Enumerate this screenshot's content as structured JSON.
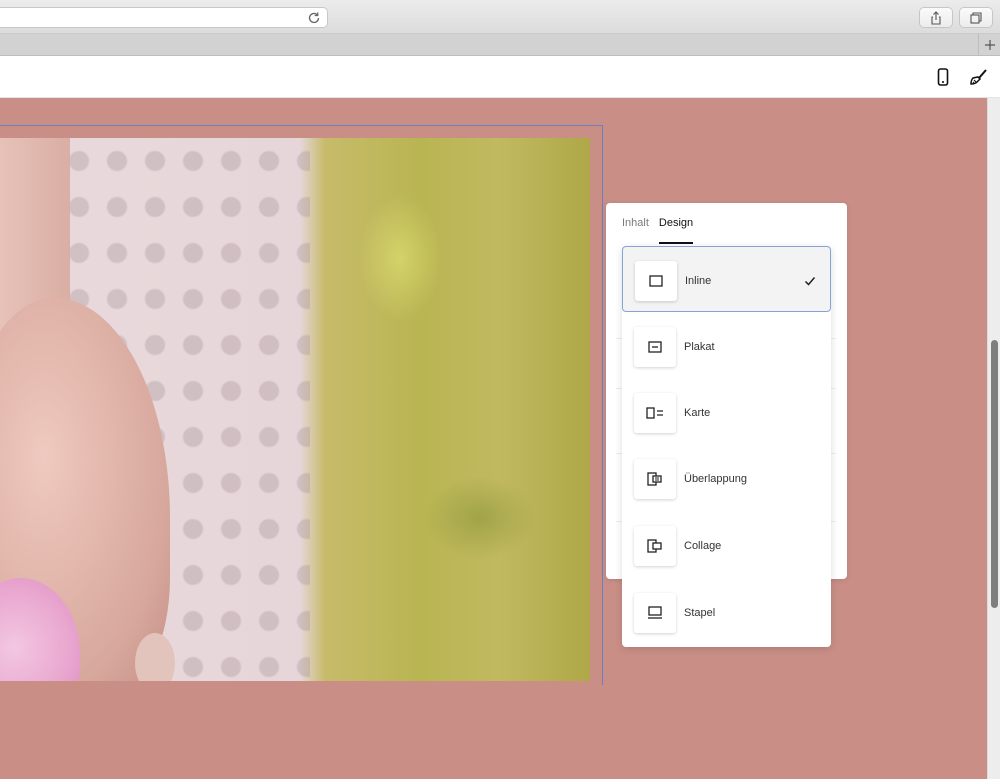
{
  "panel": {
    "tabs": [
      {
        "label": "Inhalt",
        "active": false
      },
      {
        "label": "Design",
        "active": true
      }
    ]
  },
  "dropdown": {
    "options": [
      {
        "label": "Inline",
        "icon": "layout-inline-icon",
        "selected": true
      },
      {
        "label": "Plakat",
        "icon": "layout-poster-icon",
        "selected": false
      },
      {
        "label": "Karte",
        "icon": "layout-card-icon",
        "selected": false
      },
      {
        "label": "Überlappung",
        "icon": "layout-overlap-icon",
        "selected": false
      },
      {
        "label": "Collage",
        "icon": "layout-collage-icon",
        "selected": false
      },
      {
        "label": "Stapel",
        "icon": "layout-stack-icon",
        "selected": false
      }
    ]
  },
  "colors": {
    "canvas_background": "#c98f87",
    "selection_outline": "#6e7fbf",
    "selected_option_border": "#87a2d8"
  },
  "icons": {
    "browser": [
      "reload-icon",
      "share-icon",
      "tabs-overview-icon",
      "new-tab-plus-icon"
    ],
    "toolbar": [
      "mobile-preview-icon",
      "paintbrush-icon"
    ]
  }
}
